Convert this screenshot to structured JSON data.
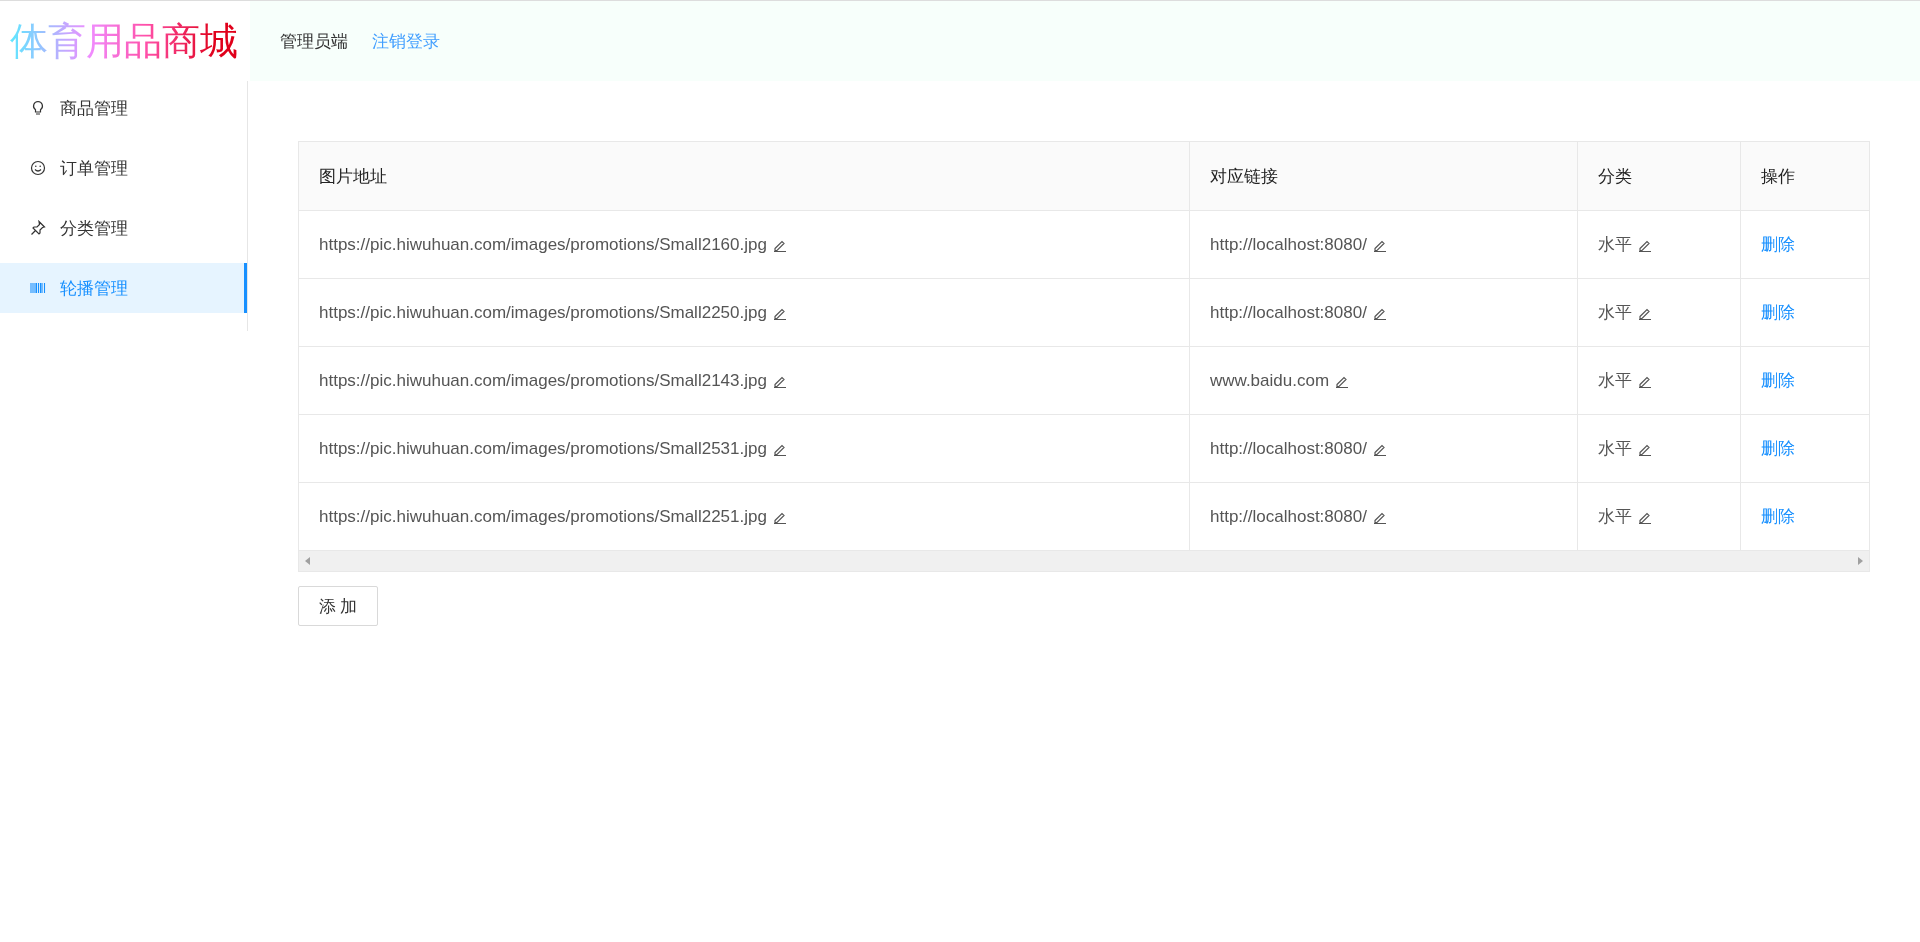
{
  "logo": "体育用品商城",
  "header": {
    "role": "管理员端",
    "logout": "注销登录"
  },
  "sidebar": {
    "items": [
      {
        "label": "商品管理",
        "selected": false
      },
      {
        "label": "订单管理",
        "selected": false
      },
      {
        "label": "分类管理",
        "selected": false
      },
      {
        "label": "轮播管理",
        "selected": true
      }
    ]
  },
  "table": {
    "columns": [
      "图片地址",
      "对应链接",
      "分类",
      "操作"
    ],
    "rows": [
      {
        "image_url": "https://pic.hiwuhuan.com/images/promotions/Small2160.jpg",
        "link": "http://localhost:8080/",
        "category": "水平",
        "action": "删除"
      },
      {
        "image_url": "https://pic.hiwuhuan.com/images/promotions/Small2250.jpg",
        "link": "http://localhost:8080/",
        "category": "水平",
        "action": "删除"
      },
      {
        "image_url": "https://pic.hiwuhuan.com/images/promotions/Small2143.jpg",
        "link": "www.baidu.com",
        "category": "水平",
        "action": "删除"
      },
      {
        "image_url": "https://pic.hiwuhuan.com/images/promotions/Small2531.jpg",
        "link": "http://localhost:8080/",
        "category": "水平",
        "action": "删除"
      },
      {
        "image_url": "https://pic.hiwuhuan.com/images/promotions/Small2251.jpg",
        "link": "http://localhost:8080/",
        "category": "水平",
        "action": "删除"
      }
    ]
  },
  "add_button": "添 加"
}
